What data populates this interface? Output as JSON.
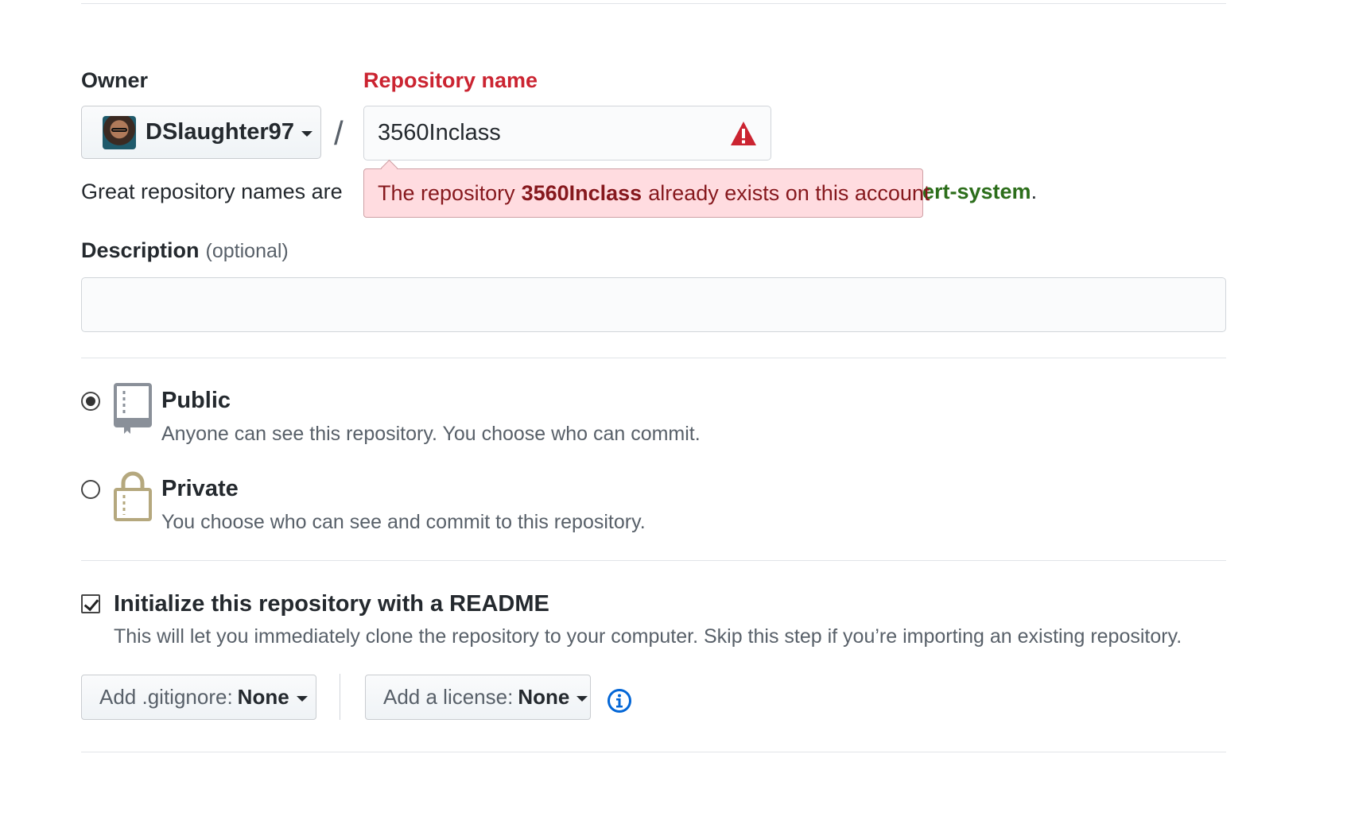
{
  "owner": {
    "label": "Owner",
    "name": "DSlaughter97"
  },
  "slash": "/",
  "repository": {
    "label": "Repository name",
    "value": "3560Inclass",
    "error_prefix": "The repository",
    "error_name": "3560Inclass",
    "error_suffix": "already exists on this account"
  },
  "hint": {
    "lead": "Great repository names are",
    "tail_suggestion": "ert-system",
    "tail_period": "."
  },
  "description": {
    "label": "Description",
    "optional": "(optional)",
    "value": ""
  },
  "visibility": {
    "public": {
      "title": "Public",
      "desc": "Anyone can see this repository. You choose who can commit.",
      "checked": true
    },
    "private": {
      "title": "Private",
      "desc": "You choose who can see and commit to this repository.",
      "checked": false
    }
  },
  "readme": {
    "title": "Initialize this repository with a README",
    "desc": "This will let you immediately clone the repository to your computer. Skip this step if you’re importing an existing repository.",
    "checked": true
  },
  "gitignore": {
    "prefix": "Add .gitignore:",
    "value": "None"
  },
  "license": {
    "prefix": "Add a license:",
    "value": "None"
  },
  "colors": {
    "error": "#cb2431",
    "link": "#0366d6",
    "success": "#28a745"
  },
  "icons": [
    "caret-down-icon",
    "alert-icon",
    "repo-icon",
    "lock-icon",
    "info-icon"
  ]
}
